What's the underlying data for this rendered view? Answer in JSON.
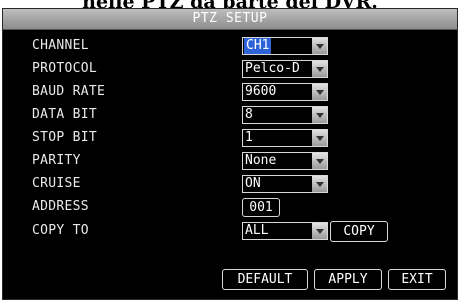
{
  "caption": "nelle PTZ da parte del DVR.",
  "dialog": {
    "title": "PTZ SETUP",
    "fields": {
      "channel": {
        "label": "CHANNEL",
        "value": "CH1"
      },
      "protocol": {
        "label": "PROTOCOL",
        "value": "Pelco-D"
      },
      "baud": {
        "label": "BAUD RATE",
        "value": "9600"
      },
      "databit": {
        "label": "DATA BIT",
        "value": "8"
      },
      "stopbit": {
        "label": "STOP BIT",
        "value": "1"
      },
      "parity": {
        "label": "PARITY",
        "value": "None"
      },
      "cruise": {
        "label": "CRUISE",
        "value": "ON"
      },
      "address": {
        "label": "ADDRESS",
        "value": "001"
      },
      "copyto": {
        "label": "COPY TO",
        "value": "ALL"
      }
    },
    "buttons": {
      "copy": "COPY",
      "default": "DEFAULT",
      "apply": "APPLY",
      "exit": "EXIT"
    }
  },
  "colors": {
    "background": "#000000",
    "highlight": "#2e63d8",
    "titlebar": "#a8a8a8",
    "text": "#ffffff"
  },
  "icons": {
    "dropdown": "chevron-down-icon"
  }
}
